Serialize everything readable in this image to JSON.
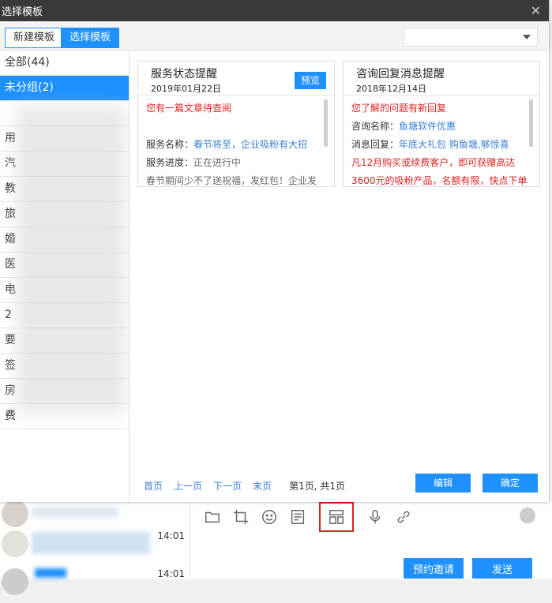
{
  "modal": {
    "title": "选择模板",
    "close_icon": "close-icon",
    "tabs": [
      {
        "label": "新建模板",
        "active": false
      },
      {
        "label": "选择模板",
        "active": true
      }
    ]
  },
  "sidebar": {
    "items": [
      {
        "label": "全部(44)",
        "selected": false
      },
      {
        "label": "未分组(2)",
        "selected": true
      },
      {
        "label": "",
        "selected": false
      },
      {
        "label": "用",
        "selected": false
      },
      {
        "label": "汽",
        "selected": false
      },
      {
        "label": "教",
        "selected": false
      },
      {
        "label": "旅",
        "selected": false
      },
      {
        "label": "婚",
        "selected": false
      },
      {
        "label": "医",
        "selected": false
      },
      {
        "label": "电",
        "selected": false
      },
      {
        "label": "2",
        "selected": false
      },
      {
        "label": "要",
        "selected": false
      },
      {
        "label": "签",
        "selected": false
      },
      {
        "label": "房",
        "selected": false
      },
      {
        "label": "费",
        "selected": false
      }
    ]
  },
  "cards": [
    {
      "title": "服务状态提醒",
      "date": "2019年01月22日",
      "preview_label": "预览",
      "lines": [
        {
          "label": "",
          "value": "您有一篇文章待查阅",
          "value_color": "red"
        },
        {
          "label": "",
          "value": "",
          "value_color": "gray"
        },
        {
          "label": "服务名称：",
          "value": "春节将至，企业吸粉有大招",
          "value_color": "blue"
        },
        {
          "label": "服务进度：",
          "value": "正在进行中",
          "value_color": "gray"
        },
        {
          "label": "",
          "value": "春节期间少不了送祝福，发红包！企业发",
          "value_color": "gray"
        }
      ]
    },
    {
      "title": "咨询回复消息提醒",
      "date": "2018年12月14日",
      "preview_label": "",
      "lines": [
        {
          "label": "",
          "value": "您了解的问题有新回复",
          "value_color": "red"
        },
        {
          "label": "咨询名称：",
          "value": "鱼塘软件优惠",
          "value_color": "blue"
        },
        {
          "label": "消息回复：",
          "value": "年底大礼包 购鱼塘,够惊喜",
          "value_color": "blue"
        },
        {
          "label": "",
          "value": "凡12月购买或续费客户，即可获赠高达",
          "value_color": "red"
        },
        {
          "label": "",
          "value": "3600元的吸粉产品，名额有限，快点下单",
          "value_color": "red"
        }
      ]
    }
  ],
  "pager": {
    "first": "首页",
    "prev": "上一页",
    "next": "下一页",
    "last": "末页",
    "info": "第1页, 共1页"
  },
  "actions": {
    "edit": "编辑",
    "confirm": "确定"
  },
  "chat": {
    "times": [
      "14:01",
      "14:01"
    ],
    "toolbar_icons": [
      "folder-icon",
      "crop-icon",
      "emoji-icon",
      "document-icon",
      "template-icon",
      "microphone-icon",
      "link-icon"
    ],
    "invite_button": "预约邀请",
    "send_button": "发送"
  },
  "colors": {
    "accent": "#1e90ff",
    "titlebar": "#3a3a3a",
    "red": "#e02020",
    "link": "#3a7fd5",
    "highlight": "#e02020"
  }
}
